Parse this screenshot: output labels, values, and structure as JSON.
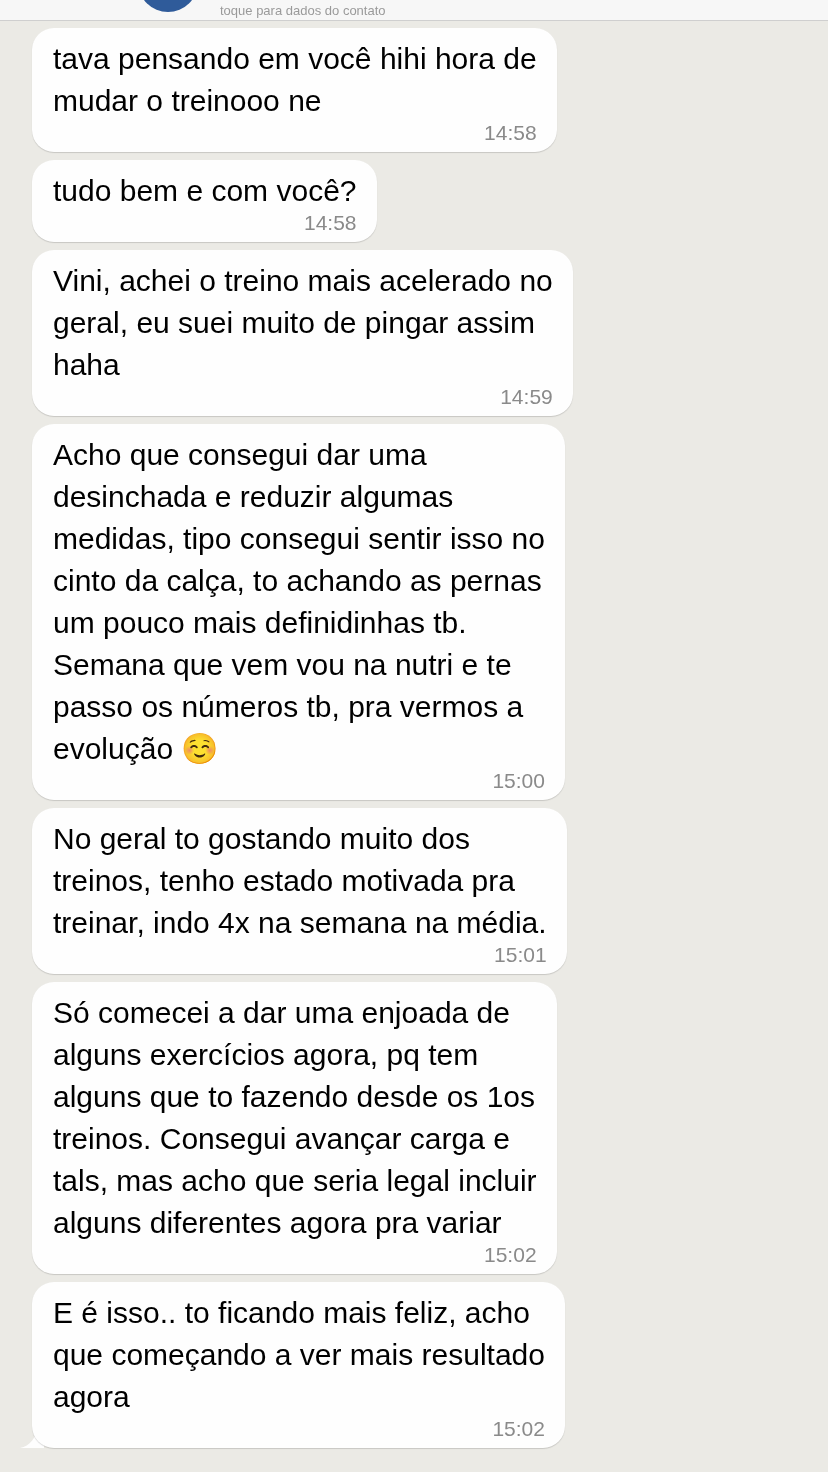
{
  "header": {
    "subtitle": "toque para dados do contato"
  },
  "messages": [
    {
      "lines": [
        "tava pensando em você hihi hora de",
        "mudar o treinooo ne"
      ],
      "time": "14:58",
      "tail": false
    },
    {
      "lines": [
        "tudo bem e com você?"
      ],
      "time": "14:58",
      "tail": false
    },
    {
      "lines": [
        "Vini, achei o treino mais acelerado no",
        "geral, eu suei muito de pingar assim",
        "haha"
      ],
      "time": "14:59",
      "tail": false
    },
    {
      "lines": [
        "Acho que consegui dar uma",
        "desinchada e reduzir algumas",
        "medidas, tipo consegui sentir isso no",
        "cinto da calça, to achando as pernas",
        "um pouco mais definidinhas tb.",
        "Semana que vem vou na nutri e te",
        "passo os números tb, pra vermos a",
        "evolução ☺️"
      ],
      "time": "15:00",
      "tail": false
    },
    {
      "lines": [
        "No geral to gostando muito dos",
        "treinos, tenho estado motivada pra",
        "treinar, indo 4x na semana na média."
      ],
      "time": "15:01",
      "tail": false
    },
    {
      "lines": [
        "Só comecei a dar uma enjoada de",
        "alguns exercícios agora, pq tem",
        "alguns que to fazendo desde os 1os",
        "treinos. Consegui avançar carga e",
        "tals, mas acho que seria legal incluir",
        "alguns diferentes agora pra variar"
      ],
      "time": "15:02",
      "tail": false
    },
    {
      "lines": [
        "E é isso.. to ficando mais feliz, acho",
        "que começando a ver mais resultado",
        "agora"
      ],
      "time": "15:02",
      "tail": true
    }
  ]
}
